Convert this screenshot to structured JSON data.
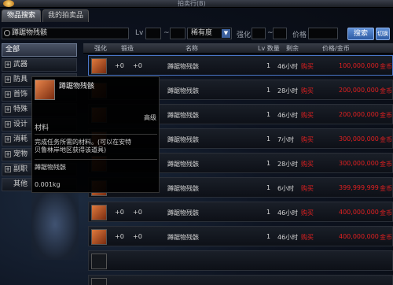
{
  "window": {
    "title": "拍卖行(B)"
  },
  "tabs": [
    {
      "label": "物品搜索"
    },
    {
      "label": "我的拍卖品"
    }
  ],
  "search": {
    "value": "蹲踞物残骸",
    "level_label": "Lv",
    "level_sep": "~",
    "rarity_value": "稀有度",
    "enhance_label": "强化",
    "enhance_sep": "~",
    "price_label": "价格",
    "search_button": "搜索",
    "toggle_button": "切换"
  },
  "categories": [
    {
      "label": "全部"
    },
    {
      "label": "武器"
    },
    {
      "label": "防具"
    },
    {
      "label": "首饰"
    },
    {
      "label": "特殊"
    },
    {
      "label": "设计"
    },
    {
      "label": "消耗"
    },
    {
      "label": "宠物"
    },
    {
      "label": "副职"
    },
    {
      "label": "其他"
    }
  ],
  "columns": {
    "enhance": "强化",
    "refine": "锻造",
    "name": "名称",
    "level_qty": "Lv 数量",
    "time": "剩余",
    "price": "价格/金币"
  },
  "rows": [
    {
      "enhance": "+0",
      "refine": "+0",
      "name": "蹲踞物残骸",
      "qty": "1",
      "time": "46小时",
      "buy": "购买",
      "price": "100,000,000",
      "unit": "金币"
    },
    {
      "enhance": "",
      "refine": "",
      "name": "蹲踞物残骸",
      "qty": "1",
      "time": "28小时",
      "buy": "购买",
      "price": "200,000,000",
      "unit": "金币"
    },
    {
      "enhance": "",
      "refine": "",
      "name": "蹲踞物残骸",
      "qty": "1",
      "time": "46小时",
      "buy": "购买",
      "price": "200,000,000",
      "unit": "金币"
    },
    {
      "enhance": "",
      "refine": "",
      "name": "蹲踞物残骸",
      "qty": "1",
      "time": "7小时",
      "buy": "购买",
      "price": "300,000,000",
      "unit": "金币"
    },
    {
      "enhance": "",
      "refine": "",
      "name": "蹲踞物残骸",
      "qty": "1",
      "time": "28小时",
      "buy": "购买",
      "price": "300,000,000",
      "unit": "金币"
    },
    {
      "enhance": "",
      "refine": "",
      "name": "蹲踞物残骸",
      "qty": "1",
      "time": "6小时",
      "buy": "购买",
      "price": "399,999,999",
      "unit": "金币"
    },
    {
      "enhance": "+0",
      "refine": "+0",
      "name": "蹲踞物残骸",
      "qty": "1",
      "time": "46小时",
      "buy": "购买",
      "price": "400,000,000",
      "unit": "金币"
    },
    {
      "enhance": "+0",
      "refine": "+0",
      "name": "蹲踞物残骸",
      "qty": "1",
      "time": "46小时",
      "buy": "购买",
      "price": "400,000,000",
      "unit": "金币"
    }
  ],
  "tooltip": {
    "name": "蹲踞物残骸",
    "grade": "高级",
    "type": "材料",
    "desc": "完成任务所需的材料。(可以在安特贝鲁林岸地区获得该道具)",
    "footer": "蹲踞物残骸",
    "weight": "0.001kg"
  }
}
